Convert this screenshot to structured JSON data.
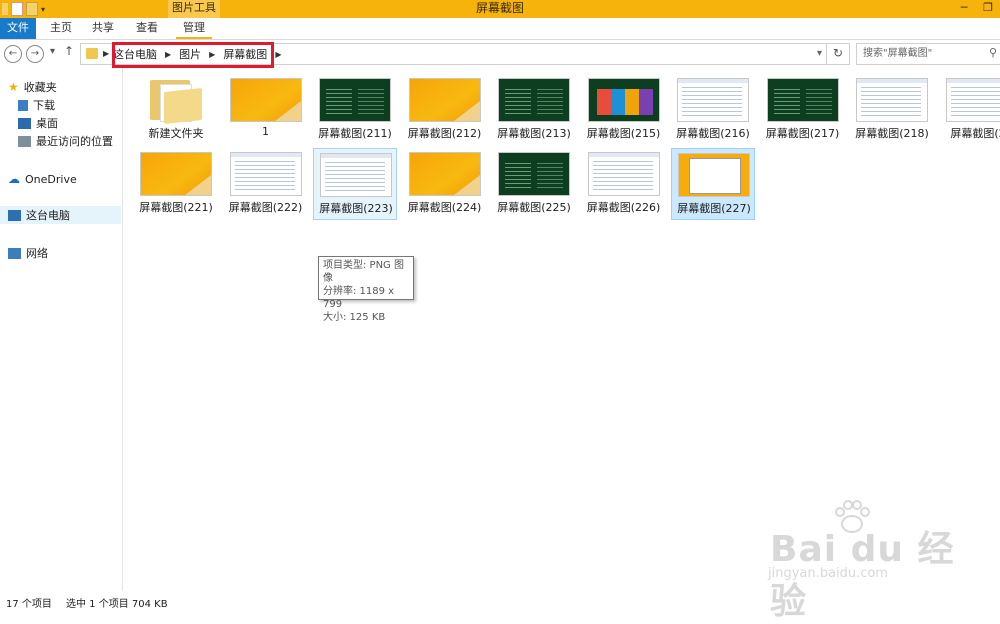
{
  "window": {
    "title": "屏幕截图",
    "context_tab": "图片工具",
    "controls": [
      "─",
      "❐"
    ]
  },
  "ribbon": {
    "tabs": [
      "文件",
      "主页",
      "共享",
      "查看",
      "管理"
    ]
  },
  "address": {
    "crumbs": [
      "这台电脑",
      "图片",
      "屏幕截图"
    ],
    "search_placeholder": "搜索\"屏幕截图\""
  },
  "nav": {
    "favorites": "收藏夹",
    "downloads": "下载",
    "desktop": "桌面",
    "recent": "最近访问的位置",
    "onedrive": "OneDrive",
    "thispc": "这台电脑",
    "network": "网络"
  },
  "files": [
    {
      "name": "新建文件夹",
      "type": "folder"
    },
    {
      "name": "1",
      "type": "orange"
    },
    {
      "name": "屏幕截图(211)",
      "type": "green"
    },
    {
      "name": "屏幕截图(212)",
      "type": "orange"
    },
    {
      "name": "屏幕截图(213)",
      "type": "green"
    },
    {
      "name": "屏幕截图(215)",
      "type": "tiles"
    },
    {
      "name": "屏幕截图(216)",
      "type": "white"
    },
    {
      "name": "屏幕截图(217)",
      "type": "green"
    },
    {
      "name": "屏幕截图(218)",
      "type": "white"
    },
    {
      "name": "屏幕截图(22",
      "type": "white"
    },
    {
      "name": "屏幕截图(221)",
      "type": "orange"
    },
    {
      "name": "屏幕截图(222)",
      "type": "white"
    },
    {
      "name": "屏幕截图(223)",
      "type": "white",
      "hover": true
    },
    {
      "name": "屏幕截图(224)",
      "type": "orange"
    },
    {
      "name": "屏幕截图(225)",
      "type": "green"
    },
    {
      "name": "屏幕截图(226)",
      "type": "white"
    },
    {
      "name": "屏幕截图(227)",
      "type": "yellowwin",
      "selected": true
    }
  ],
  "tooltip": {
    "line1": "项目类型: PNG 图像",
    "line2": "分辨率: 1189 x 799",
    "line3": "大小: 125 KB"
  },
  "status": {
    "count": "17 个项目",
    "selection": "选中 1 个项目  704 KB"
  },
  "watermark": {
    "brand": "Bai du 经验",
    "url": "jingyan.baidu.com"
  }
}
